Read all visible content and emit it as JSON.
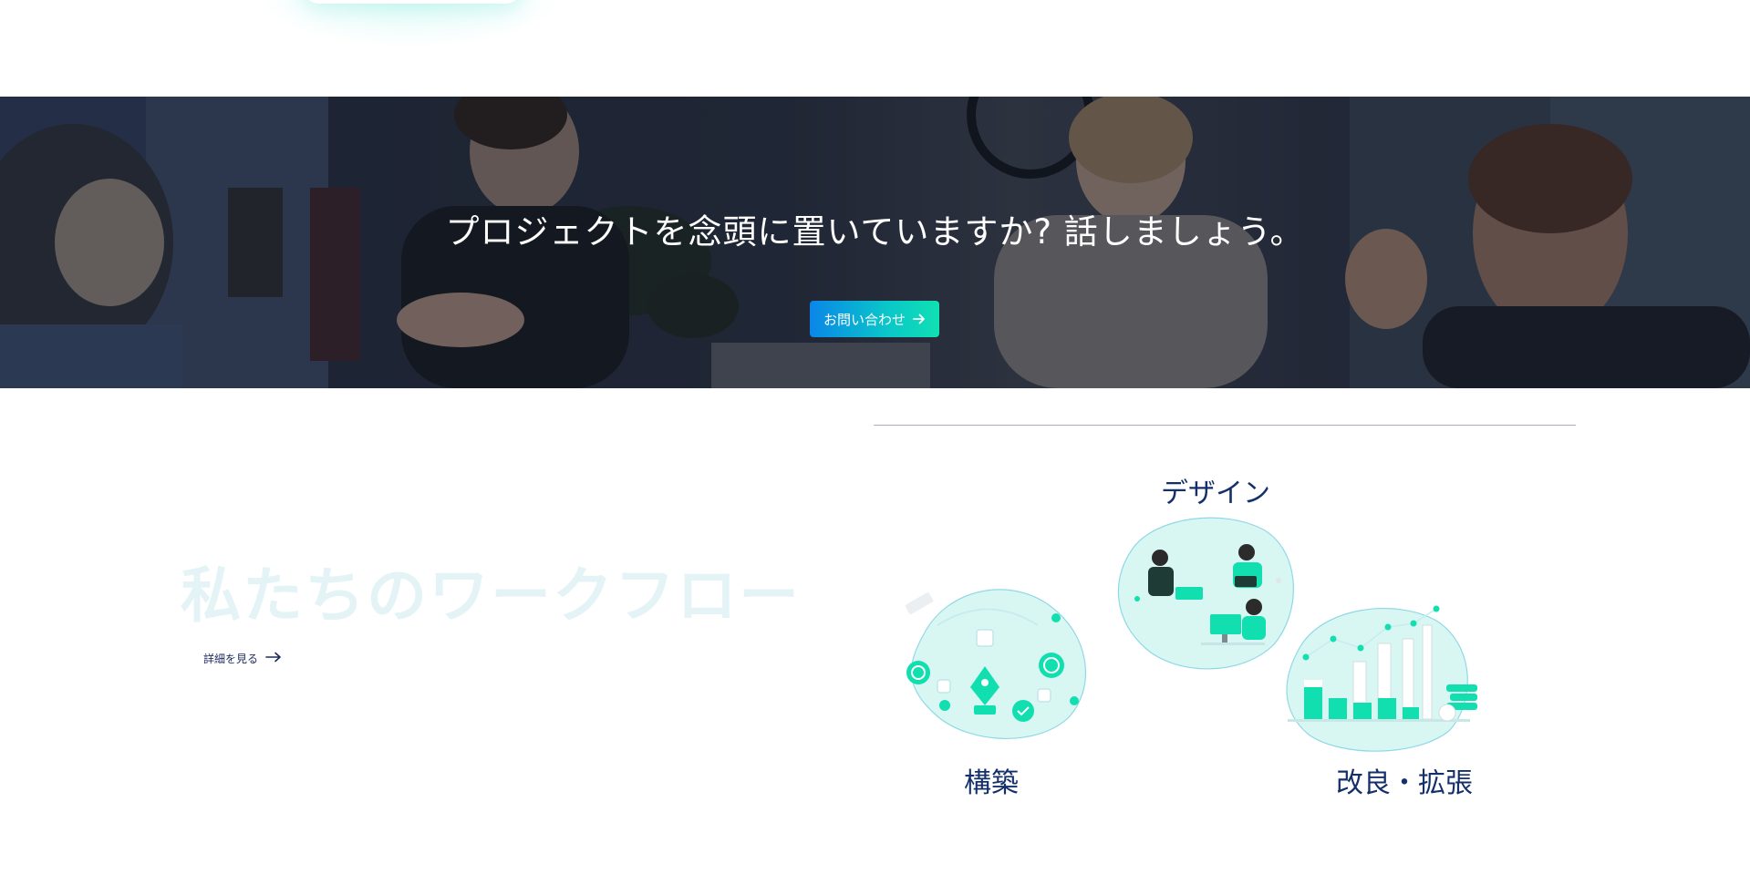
{
  "hero": {
    "title": "プロジェクトを念頭に置いていますか?  話しましょう。",
    "cta_label": "お問い合わせ"
  },
  "workflow": {
    "title": "私たちのワークフロー",
    "details_link": "詳細を見る",
    "steps": [
      {
        "label": "デザイン",
        "icon": "team-laptops-illustration"
      },
      {
        "label": "構築",
        "icon": "pen-tool-illustration"
      },
      {
        "label": "改良・拡張",
        "icon": "growth-chart-illustration"
      }
    ]
  },
  "colors": {
    "accent": "#10e0b2",
    "brand_blue": "#0a86e8",
    "heading_navy": "#14306b",
    "illustration_teal": "#12dfb0",
    "blob_fill": "#d9f7f2"
  }
}
